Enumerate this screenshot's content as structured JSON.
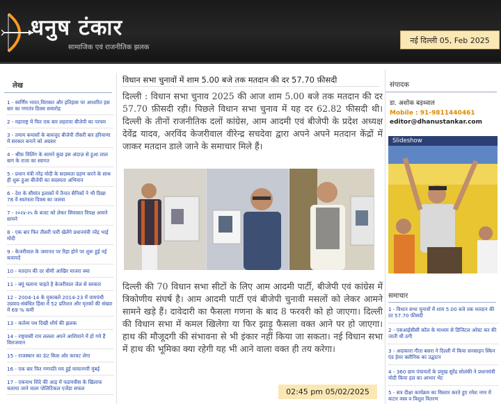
{
  "site": {
    "title": "धनुष टंकार",
    "tagline": "सामाजिक एवं राजनीतिक झलक",
    "date": "नई दिल्ली 05, Feb 2025"
  },
  "left": {
    "heading": "लेख",
    "items": [
      "1 - स्वर्णिम भारत,विरासत और इतिहास पर आधारित इस बार का गणतंत्र दिवस समारोह",
      "2 - महाराष्ट्र में फिर एक बार लहराया बीजेपी का परचम",
      "3 - तमाम कयासों के बावजूद बीजेपी तीसरी बार हरियाणा में सरकार बनाने को अग्रसर",
      "4 - श्रीफ़ विलिंग के सामने कुछ इस अंदाज़ से हुआ लाल बाग के राजा का स्वागत",
      "5 - प्रधान मंत्री नरेंद्र मोदी के सदस्यता ग्रहण करने के साथ ही शुरू हुआ बीजेपी का सदस्यता अभियान",
      "6 - देश के सीमांत इलाकों में तैनात सैनिकों ने भी दिखा 78 वें स्वतंत्रता दिवस का जलवा",
      "7 - २०२४-२५ के बजट को लेकर सियासत विपक्ष आमने सामने",
      "8 - एक बार फिर तीसरी पारी खेलेंगे प्रधानमंत्री नरेंद्र भाई मोदी",
      "9 - केजरीवाल के जमानत पर रिहा होने पर शुरू हुई नई कवायदें",
      "10 - मतदान की दर धीमी आखिर माजरा क्या",
      "11 - क्यूं चलाना चाहते है केजरीवाल जेल से सरकार",
      "12 - 2004-14 के मुकाबले 2014-23 में वामपंथी उग्रवाद-संबंधित हिंसा में 52 प्रतिशत और मृतकों की संख्या में 69 % कमी",
      "13 - कर्तव्य पथ दिखी शौर्य की झलक",
      "14 - राष्ट्रवासी राम ललला अपने आशियाने में हो गये हैं विराजमान",
      "15 - राजस्थान का ऊंट किस ओर करवट लेगा",
      "16 - एक बार फिर गणपति मय हुई मायानगरी मुंबई",
      "17 - एकनाथ शिंदे की आड़ में फडणवीस के खिलाफ चलाया जाने वाला पोलिटिकल एजेंडा सफल"
    ]
  },
  "article": {
    "headline": "विधान सभा चुनावों में शाम 5.00 बजे तक मतदान की दर 57.70 फ़ीसदी",
    "para1": "दिल्ली : विधान सभा चुनाव 2025 की आज शाम 5.00 बजे तक मतदान की दर 57.70 फ़ीसदी रही। पिछले विधान सभा चुनाव में यह दर 62.82 फीसदी थी। दिल्ली के तीनों राजनीतिक दलों कांग्रेस, आम आदमी एवं बीजेपी के प्रदेश अध्यक्ष देवेंद्र यादव, अरविंद केजरीवाल वीरेन्द्र सचदेवा द्वारा अपने अपने मतदान केंद्रों में जाकर मतदान डाले जाने के समाचार मिले हैं।",
    "para2": "दिल्ली की 70 विधान सभा सीटों के लिए आम आदमी पार्टी, बीजेपी एवं कांग्रेस में त्रिकोणीय संघर्ष है। आम आदमी पार्टी एवं बीजेपी चुनावी मसलों को लेकर आमने सामने खड़े हैं। दावेदारी का फैसला गणना के बाद 8 फरवरी को हो जाएगा। दिल्ली की विधान सभा में कमल खिलेगा या फिर झाड़ू फैसला वक्त आने पर हो जाएगा। हाथ की मौजूदगी की संभावना से भी इंकार नहीं किया जा सकता। नई विधान सभा में हाथ की भूमिका क्या रहेगी यह भी आने वाला वक्त ही तय करेगा।",
    "timestamp": "02:45 pm 05/02/2025"
  },
  "right": {
    "editor_heading": "संपादक",
    "editor_name": "डा. अशोक बड़थ्वाल",
    "mobile": "Mobile : 91-9811440461",
    "email": "editor@dhanustankar.com",
    "slideshow_label": "Slideshow",
    "news_heading": "समाचार",
    "news": [
      "1 - विधान सभा चुनावों में शाम 5.00 बजे तक मतदान की दर 57.70 फ़ीसदी",
      "2 - एसआईसीसी कॉल के माध्यम से डिजिटल अरेस्ट कर की जाती थी ठगी",
      "3 - अदाकारा गीता बसरा ने दिल्ली में किया सनसाइन स्किन एंड हेयर क्लीनिक का उद्घाटन",
      "4 - 360 ग्राम पंचायतों के प्रमुख सुरेंद्र सोलंकी ने प्रधानमंत्री मोदी किया हल का आभार भेंट",
      "5 - सत्र दीक्षा कार्यक्रम का विस्तार करते हुए रमेश नगर में कटार वस्त्र व त्रिशूल वितरण"
    ]
  }
}
